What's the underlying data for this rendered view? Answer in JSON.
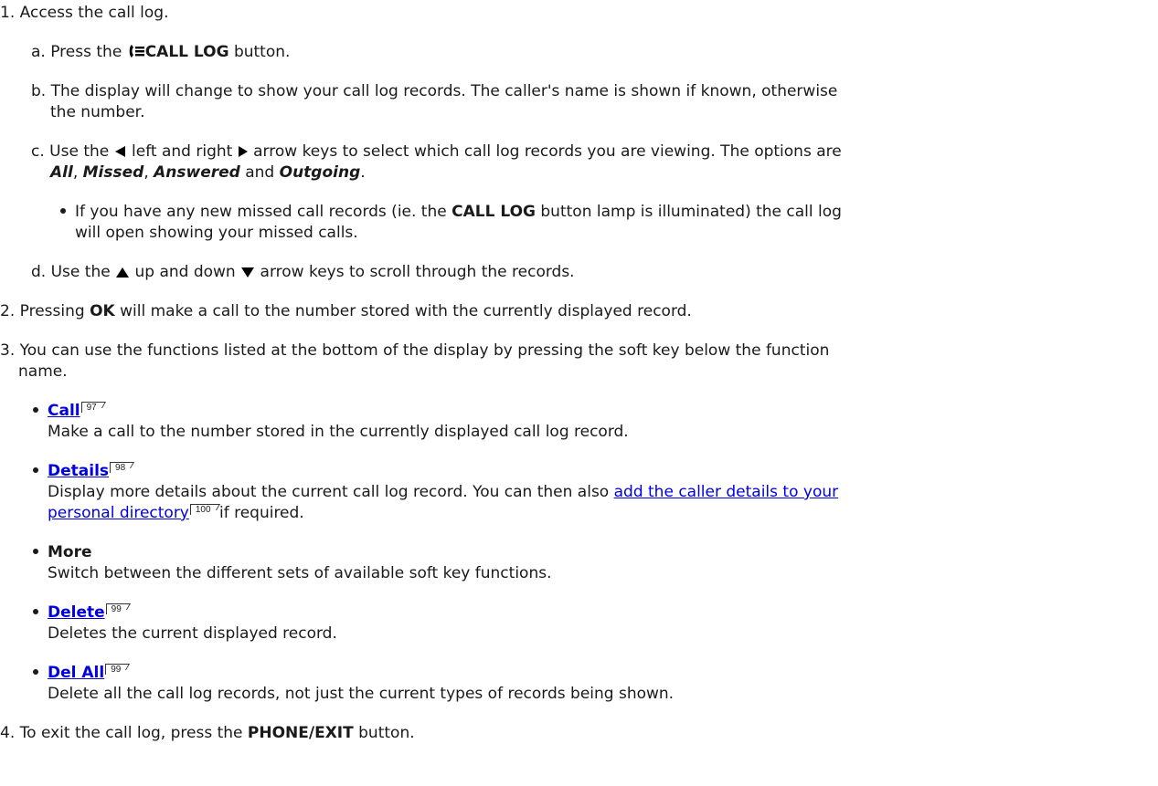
{
  "step1": {
    "num": "1.",
    "text": "Access the call log.",
    "a": {
      "letter": "a.",
      "pre": "Press the",
      "btn": "CALL LOG",
      "post": "button."
    },
    "b": {
      "letter": "b.",
      "line1": "The display will change to show your call log records. The caller's name is shown if known, otherwise",
      "line2": "the number."
    },
    "c": {
      "letter": "c.",
      "t1": "Use the",
      "t2": "left and right",
      "t3": "arrow keys to select which call log records you are viewing. The options are",
      "opt1": "All",
      "sep1": ",",
      "opt2": "Missed",
      "sep2": ",",
      "opt3": "Answered",
      "and": "and",
      "opt4": "Outgoing",
      "end": ".",
      "bullet_pre": "If you have any new missed call records (ie. the",
      "bullet_btn": "CALL LOG",
      "bullet_post": "button lamp is illuminated) the call log",
      "bullet_line2": "will open showing your missed calls."
    },
    "d": {
      "letter": "d.",
      "t1": "Use the",
      "t2": "up and down",
      "t3": "arrow keys to scroll through the records."
    }
  },
  "step2": {
    "num": "2.",
    "pre": "Pressing",
    "key": "OK",
    "post": "will make a call to the number stored with the currently displayed record."
  },
  "step3": {
    "num": "3.",
    "line1": "You can use the functions listed at the bottom of the display by pressing the soft key below the function",
    "line2": "name.",
    "items": [
      {
        "label": "Call",
        "page": "97",
        "desc": "Make a call to the number stored in the currently displayed call log record."
      },
      {
        "label": "Details",
        "page": "98",
        "desc_pre": "Display more details about the current call log record. You can then also",
        "link1": "add the caller details to your",
        "link2": "personal directory",
        "link_page": "100",
        "desc_post": "if required."
      },
      {
        "label": "More",
        "desc": "Switch between the different sets of available soft key functions."
      },
      {
        "label": "Delete",
        "page": "99",
        "desc": "Deletes the current displayed record."
      },
      {
        "label": "Del All",
        "page": "99",
        "desc": "Delete all the call log records, not just the current types of records being shown."
      }
    ]
  },
  "step4": {
    "num": "4.",
    "pre": "To exit the call log, press the",
    "btn": "PHONE/EXIT",
    "post": "button."
  }
}
